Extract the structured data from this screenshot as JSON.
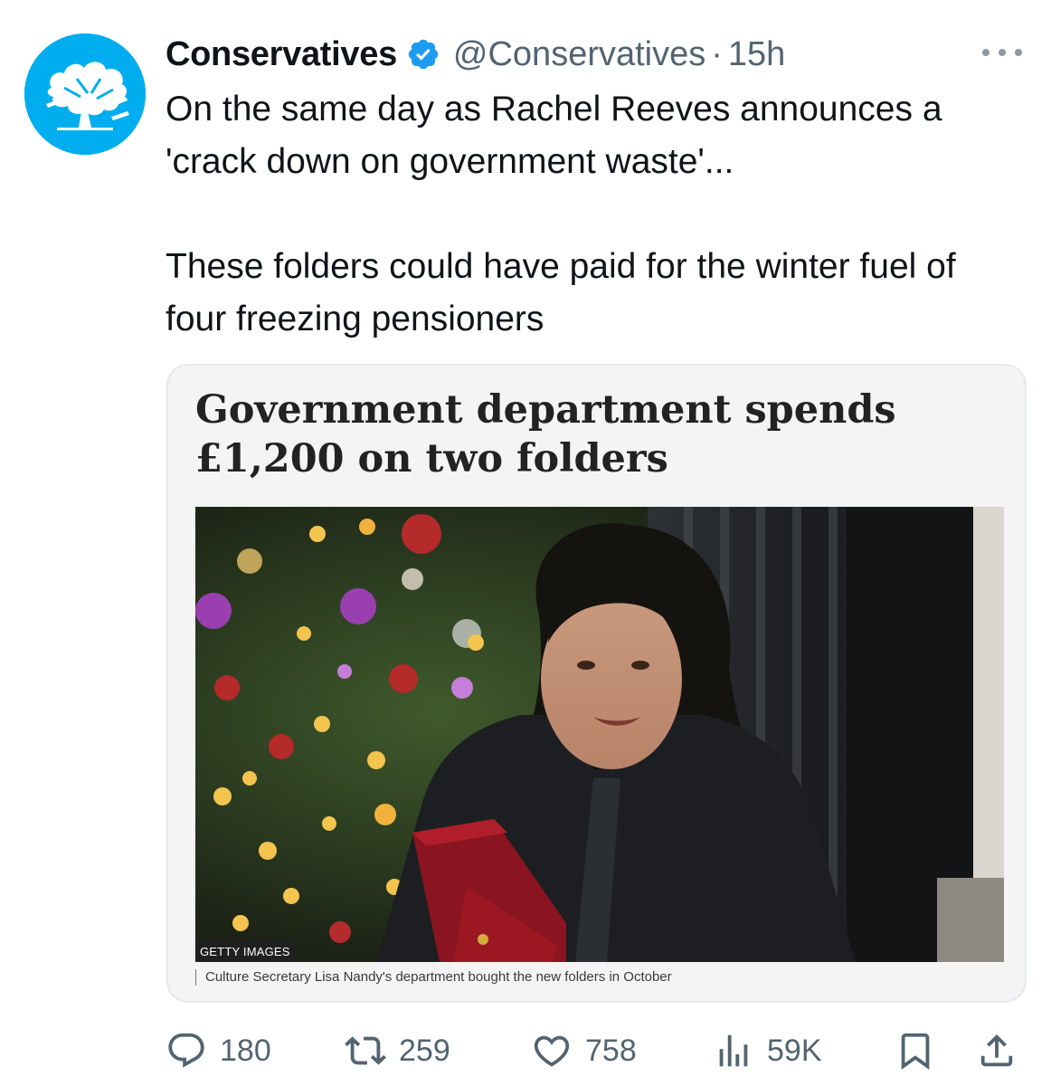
{
  "tweet": {
    "author_name": "Conservatives",
    "handle": "@Conservatives",
    "separator": "·",
    "time": "15h",
    "text_line_1": "On the same day as Rachel Reeves announces a 'crack down on government waste'...",
    "text_line_2": "These folders could have paid for the winter fuel of four freezing pensioners"
  },
  "card": {
    "headline": "Government department spends £1,200 on two folders",
    "image_credit": "GETTY IMAGES",
    "caption": "Culture Secretary Lisa Nandy's department bought the new folders in October"
  },
  "actions": {
    "replies": "180",
    "reposts": "259",
    "likes": "758",
    "views": "59K"
  },
  "icons": {
    "verified": "verified-badge-icon",
    "more": "more-icon",
    "reply": "reply-icon",
    "repost": "repost-icon",
    "like": "heart-icon",
    "views": "views-icon",
    "bookmark": "bookmark-icon",
    "share": "share-icon"
  },
  "colors": {
    "brand_blue": "#00aeef",
    "verified_blue": "#1d9bf0",
    "secondary_text": "#536471",
    "primary_text": "#0f1419"
  }
}
